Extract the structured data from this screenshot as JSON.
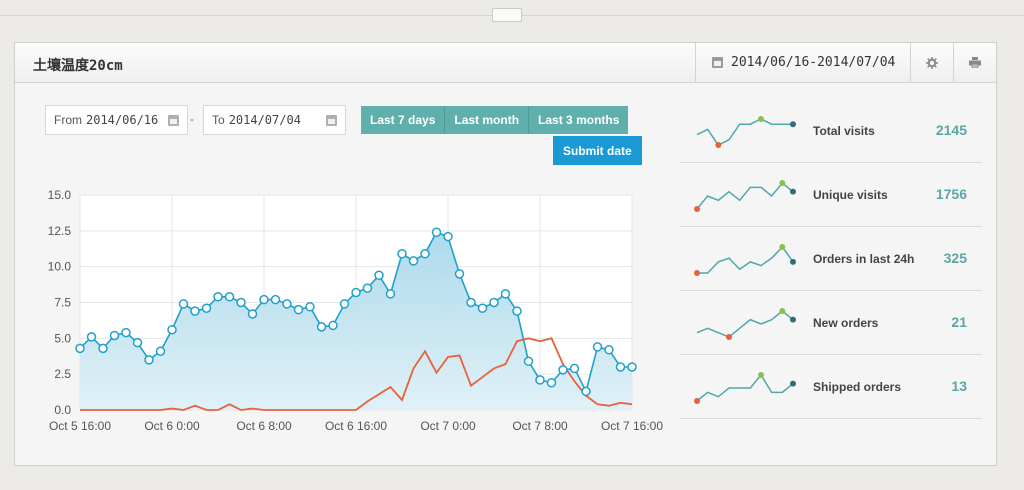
{
  "panel": {
    "title": "土壤温度20cm",
    "date_range": "2014/06/16-2014/07/04",
    "icons": [
      "calendar-icon",
      "gear-icon",
      "print-icon"
    ]
  },
  "filters": {
    "from_label": "From",
    "from_value": "2014/06/16",
    "to_label": "To",
    "to_value": "2014/07/04",
    "separator": "-",
    "buttons": [
      "Last 7 days",
      "Last month",
      "Last 3 months"
    ],
    "submit_label": "Submit date"
  },
  "colors": {
    "accent": "#5fb0ad",
    "submit": "#1a9ad4",
    "series_blue": "#1fa0cc",
    "series_orange": "#e8613c",
    "sparkline": "#4fa7ae",
    "min_dot": "#e8613c",
    "max_dot": "#8cc152",
    "last_dot": "#2f6f7a"
  },
  "chart_data": {
    "type": "area",
    "title": "",
    "xlabel": "",
    "ylabel": "",
    "ylim": [
      0,
      15
    ],
    "yticks": [
      "0.0",
      "2.5",
      "5.0",
      "7.5",
      "10.0",
      "12.5",
      "15.0"
    ],
    "xlim": [
      0,
      48
    ],
    "xticks": [
      {
        "x": 0,
        "label": "Oct 5 16:00"
      },
      {
        "x": 8,
        "label": "Oct 6 0:00"
      },
      {
        "x": 16,
        "label": "Oct 6 8:00"
      },
      {
        "x": 24,
        "label": "Oct 6 16:00"
      },
      {
        "x": 32,
        "label": "Oct 7 0:00"
      },
      {
        "x": 40,
        "label": "Oct 7 8:00"
      },
      {
        "x": 48,
        "label": "Oct 7 16:00"
      }
    ],
    "grid": true,
    "series": [
      {
        "type": "area",
        "x": [
          0,
          1,
          2,
          3,
          4,
          5,
          6,
          7,
          8,
          9,
          10,
          11,
          12,
          13,
          14,
          15,
          16,
          17,
          18,
          19,
          20,
          21,
          22,
          23,
          24,
          25,
          26,
          27,
          28,
          29,
          30,
          31,
          32,
          33,
          34,
          35,
          36,
          37,
          38,
          39,
          40,
          41,
          42,
          43,
          44,
          45,
          46,
          47,
          48
        ],
        "y": [
          4.3,
          5.1,
          4.3,
          5.2,
          5.4,
          4.7,
          3.5,
          4.1,
          5.6,
          7.4,
          6.9,
          7.1,
          7.9,
          7.9,
          7.5,
          6.7,
          7.7,
          7.7,
          7.4,
          7.0,
          7.2,
          5.8,
          5.9,
          7.4,
          8.2,
          8.5,
          9.4,
          8.1,
          10.9,
          10.4,
          10.9,
          12.4,
          12.1,
          9.5,
          7.5,
          7.1,
          7.5,
          8.1,
          6.9,
          3.4,
          2.1,
          1.9,
          2.8,
          2.9,
          1.3,
          4.4,
          4.2,
          3.0,
          3.0
        ]
      },
      {
        "type": "line",
        "x": [
          0,
          1,
          2,
          3,
          4,
          5,
          6,
          7,
          8,
          9,
          10,
          11,
          12,
          13,
          14,
          15,
          16,
          17,
          18,
          19,
          20,
          21,
          22,
          23,
          24,
          25,
          26,
          27,
          28,
          29,
          30,
          31,
          32,
          33,
          34,
          35,
          36,
          37,
          38,
          39,
          40,
          41,
          42,
          43,
          44,
          45,
          46,
          47,
          48
        ],
        "y": [
          0,
          0,
          0,
          0,
          0,
          0,
          0,
          0,
          0.1,
          0,
          0.3,
          0,
          0,
          0.4,
          0,
          0.1,
          0,
          0,
          0,
          0,
          0,
          0,
          0,
          0,
          0,
          0.6,
          1.1,
          1.6,
          0.7,
          2.9,
          4.1,
          2.6,
          3.7,
          3.8,
          1.7,
          2.3,
          2.9,
          3.2,
          4.8,
          5.0,
          4.8,
          5.0,
          3.2,
          2.0,
          1.0,
          0.4,
          0.3,
          0.5,
          0.4
        ]
      }
    ]
  },
  "stats": [
    {
      "label": "Total visits",
      "value": "2145",
      "spark": [
        4,
        5,
        2,
        3,
        6,
        6,
        7,
        6,
        6,
        6
      ],
      "min_i": 2,
      "max_i": 6
    },
    {
      "label": "Unique visits",
      "value": "1756",
      "spark": [
        2,
        5,
        4,
        6,
        4,
        7,
        7,
        5,
        8,
        6
      ],
      "min_i": 0,
      "max_i": 8
    },
    {
      "label": "Orders in last 24h",
      "value": "325",
      "spark": [
        2,
        2,
        5,
        6,
        3,
        5,
        4,
        6,
        9,
        5
      ],
      "min_i": 0,
      "max_i": 8
    },
    {
      "label": "New orders",
      "value": "21",
      "spark": [
        3,
        4,
        3,
        2,
        4,
        6,
        5,
        6,
        8,
        6
      ],
      "min_i": 3,
      "max_i": 8
    },
    {
      "label": "Shipped orders",
      "value": "13",
      "spark": [
        2,
        4,
        3,
        5,
        5,
        5,
        8,
        4,
        4,
        6
      ],
      "min_i": 0,
      "max_i": 6
    }
  ]
}
